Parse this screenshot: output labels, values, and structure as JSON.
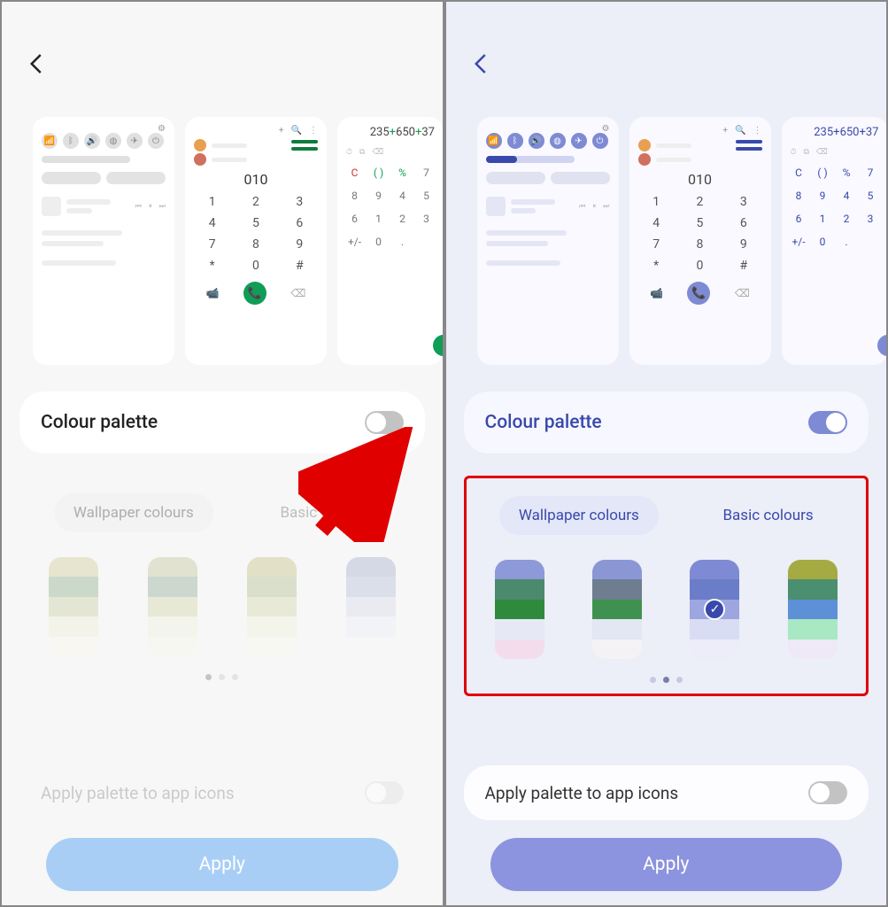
{
  "left": {
    "back_icon": "back-chevron-icon",
    "color": {
      "back": "#222"
    },
    "previews": {
      "qs_icons": [
        "wifi",
        "bt",
        "sound",
        "globe",
        "airplane",
        "power"
      ],
      "dialer": {
        "top_icons": [
          "+",
          "🔍",
          "⋮"
        ],
        "number": "010",
        "keys": [
          "1",
          "2",
          "3",
          "4",
          "5",
          "6",
          "7",
          "8",
          "9",
          "*",
          "0",
          "#"
        ],
        "bottom": {
          "video": "📹",
          "call": "📞",
          "back": "⌫"
        }
      },
      "calc": {
        "expr_parts": [
          {
            "t": "235",
            "c": "n"
          },
          {
            "t": "+",
            "c": "op"
          },
          {
            "t": "650",
            "c": "n"
          },
          {
            "t": "+",
            "c": "op"
          },
          {
            "t": "37",
            "c": "n"
          }
        ],
        "row_icons": [
          "⏱",
          "⧉",
          "⌫"
        ],
        "keys": [
          {
            "t": "C",
            "c": "cc"
          },
          {
            "t": "( )",
            "c": "gg"
          },
          {
            "t": "%",
            "c": "gg"
          },
          {
            "t": "7",
            "c": ""
          },
          {
            "t": "8",
            "c": ""
          },
          {
            "t": "9",
            "c": ""
          },
          {
            "t": "4",
            "c": ""
          },
          {
            "t": "5",
            "c": ""
          },
          {
            "t": "6",
            "c": ""
          },
          {
            "t": "1",
            "c": ""
          },
          {
            "t": "2",
            "c": ""
          },
          {
            "t": "3",
            "c": ""
          },
          {
            "t": "+/-",
            "c": ""
          },
          {
            "t": "0",
            "c": ""
          },
          {
            "t": ".",
            "c": ""
          }
        ]
      }
    },
    "palette": {
      "label": "Colour palette",
      "enabled": false
    },
    "tabs": [
      {
        "label": "Wallpaper colours",
        "active": true
      },
      {
        "label": "Basic colours",
        "active": false
      }
    ],
    "swatches": [
      {
        "colors": [
          "#d8d28c",
          "#8cb98a",
          "#c8d498",
          "#f3f0d0",
          "#fbf8e6"
        ],
        "selected": false
      },
      {
        "colors": [
          "#c7cc8e",
          "#8db59a",
          "#d4d7a0",
          "#f0f2d8",
          "#faf9ea"
        ],
        "selected": false
      },
      {
        "colors": [
          "#cbc97a",
          "#b6c784",
          "#d6dca2",
          "#eff2d2",
          "#f9faea"
        ],
        "selected": false
      },
      {
        "colors": [
          "#a8b6e0",
          "#b6c3e3",
          "#d7ddf0",
          "#eceff8",
          "#f7f8fc"
        ],
        "selected": false
      }
    ],
    "dots": {
      "count": 3,
      "active_index": 0
    },
    "apply_icons": {
      "label": "Apply palette to app icons",
      "enabled": false
    },
    "apply_button": "Apply",
    "annotation": {
      "arrow_points_to": "colour-palette-toggle"
    }
  },
  "right": {
    "back_icon": "back-chevron-icon",
    "color": {
      "back": "#3949ab"
    },
    "previews": {
      "qs_icons": [
        "wifi",
        "bt",
        "sound",
        "globe",
        "airplane",
        "power"
      ],
      "dialer": {
        "top_icons": [
          "+",
          "🔍",
          "⋮"
        ],
        "number": "010",
        "keys": [
          "1",
          "2",
          "3",
          "4",
          "5",
          "6",
          "7",
          "8",
          "9",
          "*",
          "0",
          "#"
        ],
        "bottom": {
          "video": "📹",
          "call": "📞",
          "back": "⌫"
        }
      },
      "calc": {
        "expr_parts": [
          {
            "t": "235",
            "c": "n"
          },
          {
            "t": "+",
            "c": "op"
          },
          {
            "t": "650",
            "c": "n"
          },
          {
            "t": "+",
            "c": "op"
          },
          {
            "t": "37",
            "c": "n"
          }
        ],
        "row_icons": [
          "⏱",
          "⧉",
          "⌫"
        ],
        "keys": [
          {
            "t": "C",
            "c": "cc"
          },
          {
            "t": "( )",
            "c": "gg"
          },
          {
            "t": "%",
            "c": "gg"
          },
          {
            "t": "7",
            "c": ""
          },
          {
            "t": "8",
            "c": ""
          },
          {
            "t": "9",
            "c": ""
          },
          {
            "t": "4",
            "c": ""
          },
          {
            "t": "5",
            "c": ""
          },
          {
            "t": "6",
            "c": ""
          },
          {
            "t": "1",
            "c": ""
          },
          {
            "t": "2",
            "c": ""
          },
          {
            "t": "3",
            "c": ""
          },
          {
            "t": "+/-",
            "c": ""
          },
          {
            "t": "0",
            "c": ""
          },
          {
            "t": ".",
            "c": ""
          }
        ]
      }
    },
    "palette": {
      "label": "Colour palette",
      "enabled": true
    },
    "tabs": [
      {
        "label": "Wallpaper colours",
        "active": true
      },
      {
        "label": "Basic colours",
        "active": false
      }
    ],
    "swatches": [
      {
        "colors": [
          "#8d99d8",
          "#4b8a6c",
          "#2f8a3e",
          "#e6e9f5",
          "#f3ddec"
        ],
        "selected": false
      },
      {
        "colors": [
          "#8b97d4",
          "#6e7d8f",
          "#3f9150",
          "#e3e6f3",
          "#f5f2f6"
        ],
        "selected": false
      },
      {
        "colors": [
          "#7e8ad3",
          "#6b7dc8",
          "#9da6e0",
          "#d9ddf3",
          "#ecedf8"
        ],
        "selected": true
      },
      {
        "colors": [
          "#a5aa42",
          "#4a8f70",
          "#5e90d8",
          "#a8e8c2",
          "#efe8f6"
        ],
        "selected": false
      }
    ],
    "dots": {
      "count": 3,
      "active_index": 1
    },
    "apply_icons": {
      "label": "Apply palette to app icons",
      "enabled": false
    },
    "apply_button": "Apply",
    "annotation": {
      "highlight_box_around": "swatch-section"
    }
  }
}
